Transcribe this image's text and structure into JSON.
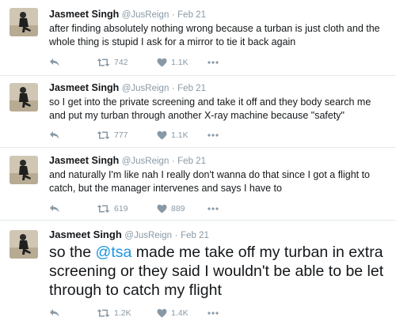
{
  "tweets": [
    {
      "name": "Jasmeet Singh",
      "handle": "@JusReign",
      "date": "Feb 21",
      "text": "after finding absolutely nothing wrong because a turban is just cloth and the whole thing is stupid I ask for a mirror to tie it back again",
      "retweets": "742",
      "likes": "1.1K"
    },
    {
      "name": "Jasmeet Singh",
      "handle": "@JusReign",
      "date": "Feb 21",
      "text": "so I get into the private screening and take it off and they body search me and put my turban through another X-ray machine because \"safety\"",
      "retweets": "777",
      "likes": "1.1K"
    },
    {
      "name": "Jasmeet Singh",
      "handle": "@JusReign",
      "date": "Feb 21",
      "text": "and naturally I'm like nah I really don't wanna do that since I got a flight to catch, but the manager intervenes and says I have to",
      "retweets": "619",
      "likes": "889"
    },
    {
      "name": "Jasmeet Singh",
      "handle": "@JusReign",
      "date": "Feb 21",
      "text_before": "so the ",
      "mention": "@tsa",
      "text_after": " made me take off my turban in extra screening or they said I wouldn't be able to be let through to catch my flight",
      "retweets": "1.2K",
      "likes": "1.4K"
    }
  ],
  "separator": "·",
  "icons": {
    "reply": "reply-icon",
    "retweet": "retweet-icon",
    "like": "heart-icon",
    "more": "more-icon"
  },
  "colors": {
    "icon": "#8899a6",
    "link": "#1b95e0",
    "divider": "#e1e8ed"
  }
}
